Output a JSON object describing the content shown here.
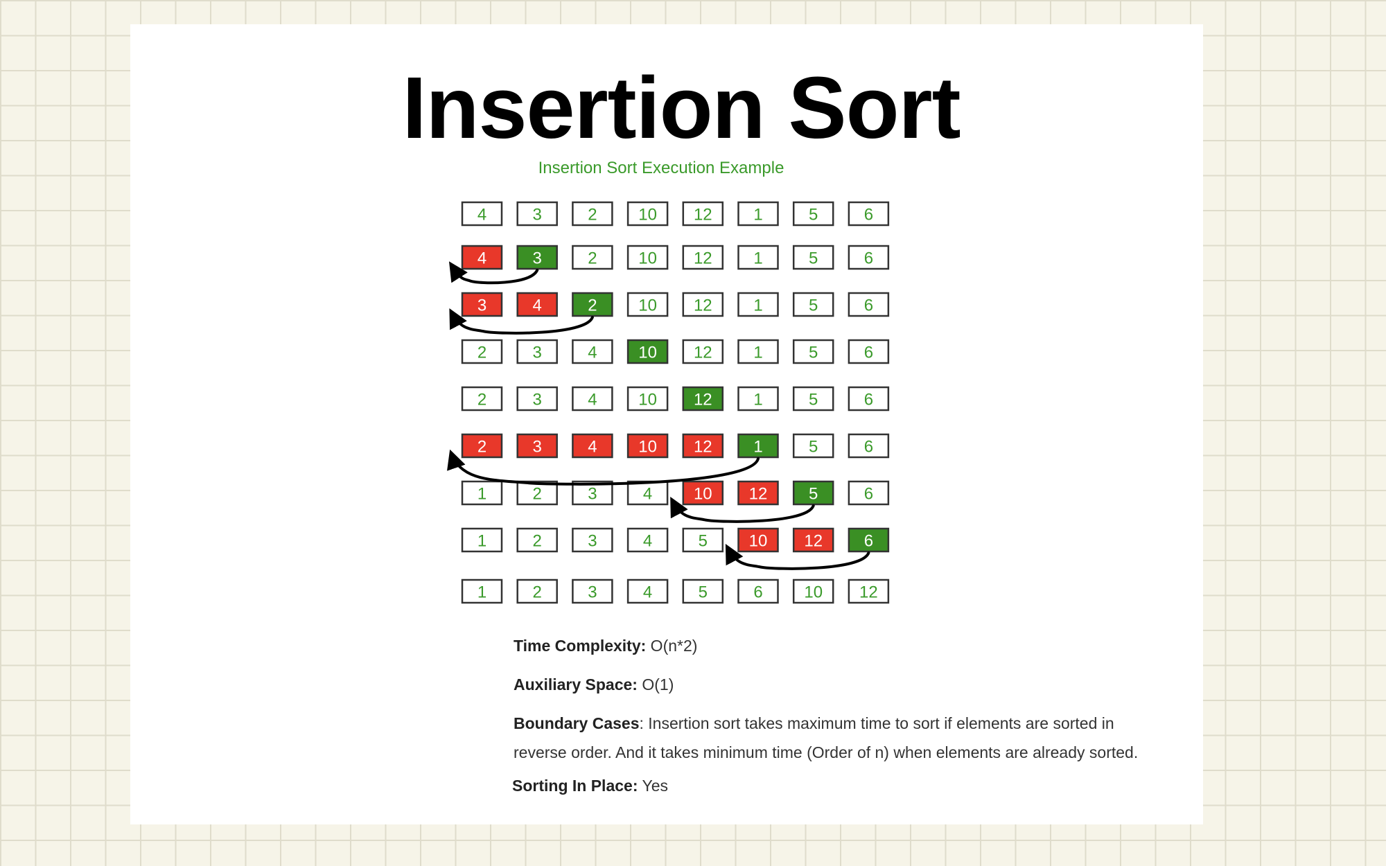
{
  "title": "Insertion Sort",
  "diagram": {
    "caption": "Insertion Sort Execution Example",
    "colors": {
      "text_green": "#3a9a2a",
      "fill_red": "#e8382a",
      "fill_green": "#3a8f24",
      "box_border": "#333333",
      "arrow": "#000000"
    },
    "rows": [
      {
        "values": [
          "4",
          "3",
          "2",
          "10",
          "12",
          "1",
          "5",
          "6"
        ],
        "states": [
          "n",
          "n",
          "n",
          "n",
          "n",
          "n",
          "n",
          "n"
        ]
      },
      {
        "values": [
          "4",
          "3",
          "2",
          "10",
          "12",
          "1",
          "5",
          "6"
        ],
        "states": [
          "r",
          "g",
          "n",
          "n",
          "n",
          "n",
          "n",
          "n"
        ],
        "arrow": {
          "from": 1,
          "to": 0
        }
      },
      {
        "values": [
          "3",
          "4",
          "2",
          "10",
          "12",
          "1",
          "5",
          "6"
        ],
        "states": [
          "r",
          "r",
          "g",
          "n",
          "n",
          "n",
          "n",
          "n"
        ],
        "arrow": {
          "from": 2,
          "to": 0
        }
      },
      {
        "values": [
          "2",
          "3",
          "4",
          "10",
          "12",
          "1",
          "5",
          "6"
        ],
        "states": [
          "n",
          "n",
          "n",
          "g",
          "n",
          "n",
          "n",
          "n"
        ]
      },
      {
        "values": [
          "2",
          "3",
          "4",
          "10",
          "12",
          "1",
          "5",
          "6"
        ],
        "states": [
          "n",
          "n",
          "n",
          "n",
          "g",
          "n",
          "n",
          "n"
        ]
      },
      {
        "values": [
          "2",
          "3",
          "4",
          "10",
          "12",
          "1",
          "5",
          "6"
        ],
        "states": [
          "r",
          "r",
          "r",
          "r",
          "r",
          "g",
          "n",
          "n"
        ],
        "arrow": {
          "from": 5,
          "to": 0
        }
      },
      {
        "values": [
          "1",
          "2",
          "3",
          "4",
          "10",
          "12",
          "5",
          "6"
        ],
        "states": [
          "n",
          "n",
          "n",
          "n",
          "r",
          "r",
          "g",
          "n"
        ],
        "arrow": {
          "from": 6,
          "to": 4
        }
      },
      {
        "values": [
          "1",
          "2",
          "3",
          "4",
          "5",
          "10",
          "12",
          "6"
        ],
        "states": [
          "n",
          "n",
          "n",
          "n",
          "n",
          "r",
          "r",
          "g"
        ],
        "arrow": {
          "from": 7,
          "to": 5
        }
      },
      {
        "values": [
          "1",
          "2",
          "3",
          "4",
          "5",
          "6",
          "10",
          "12"
        ],
        "states": [
          "n",
          "n",
          "n",
          "n",
          "n",
          "n",
          "n",
          "n"
        ]
      }
    ]
  },
  "info": {
    "time_label": "Time Complexity:",
    "time_value": " O(n*2)",
    "space_label": "Auxiliary Space:",
    "space_value": " O(1)",
    "boundary_label": "Boundary Cases",
    "boundary_value": ": Insertion sort takes maximum time to sort if elements are sorted in reverse order. And it takes minimum time (Order of n) when elements are already sorted.",
    "inplace_label": "Sorting In Place:",
    "inplace_value": " Yes"
  }
}
